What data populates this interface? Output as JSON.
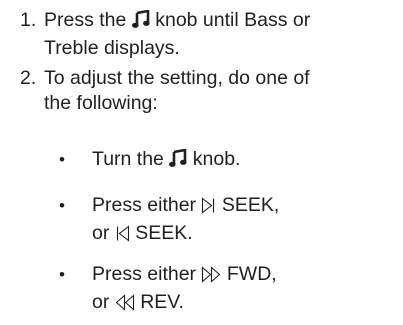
{
  "steps": [
    {
      "number": "1.",
      "line1_before": "Press the",
      "line1_after": "knob until Bass or",
      "line2": "Treble displays."
    },
    {
      "number": "2.",
      "line1": "To adjust the setting, do one of",
      "line2": "the following:"
    }
  ],
  "bullets": [
    {
      "marker": "•",
      "line1_before": "Turn the",
      "line1_after": "knob.",
      "icon": "music-note-icon"
    },
    {
      "marker": "•",
      "line1_before": "Press either",
      "line1_after": "SEEK,",
      "line2_before": "or",
      "line2_after": "SEEK.",
      "icons": [
        "seek-forward-icon",
        "seek-back-icon"
      ]
    },
    {
      "marker": "•",
      "line1_before": "Press either",
      "line1_after": "FWD,",
      "line2_before": "or",
      "line2_after": "REV.",
      "icons": [
        "fast-forward-icon",
        "rewind-icon"
      ]
    }
  ]
}
